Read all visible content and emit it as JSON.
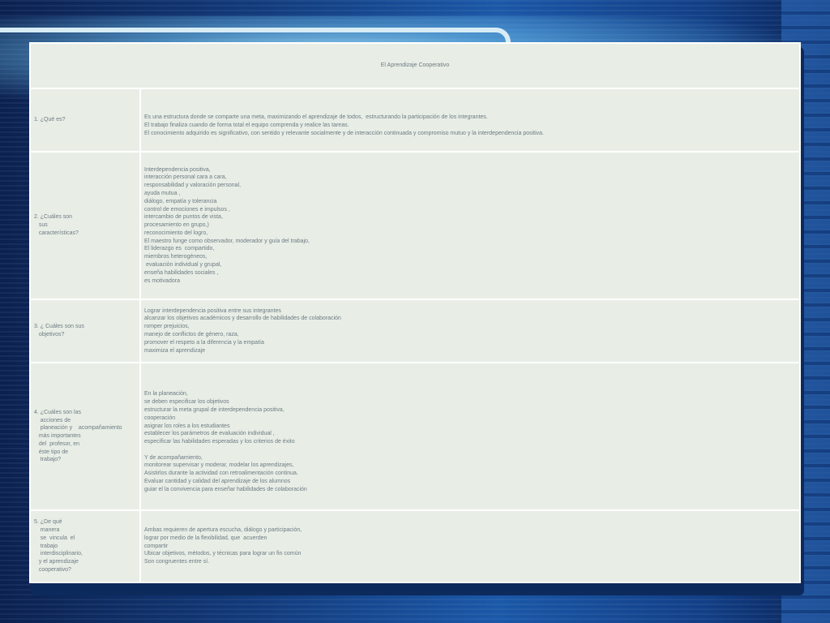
{
  "title": "El Aprendizaje Cooperativo",
  "rows": [
    {
      "question": [
        "1. ¿Qué es?"
      ],
      "answer": [
        "Es una estructura donde se comparte una meta, maximizando el aprendizaje de todos,  estructurando la participación de los integrantes.",
        "El trabajo finaliza cuando de forma total el equipo comprenda y realice las tareas.",
        "El conocimiento adquirido es significativo, con sentido y relevante socialmente y de interacción continuada y compromiso mutuo y la interdependencia positiva."
      ]
    },
    {
      "question": [
        "2. ¿Cuáles son",
        "   sus",
        "   características?"
      ],
      "answer": [
        "Interdependencia positiva,",
        "interacción personal cara a cara,",
        "responsabilidad y valoración personal,",
        "ayuda mutua ,",
        "diálogo, empatía y tolerancia",
        "control de emociones e impulsos ,",
        "intercambio de puntos de vista,",
        "procesamiento en grupo,)",
        "reconocimiento del logro,",
        "El maestro funge como observador, moderador y guía del trabajo,",
        "El liderazgo es  compartido,",
        "miembros heterogéneos,",
        " evaluación individual y grupal,",
        "enseña habilidades sociales ,",
        "es motivadora"
      ]
    },
    {
      "question": [
        "3. ¿ Cuáles son sus",
        "   objetivos?"
      ],
      "answer": [
        "Lograr interdependencia positiva entre sus integrantes",
        "alcanzar los objetivos académicos y desarrollo de habilidades de colaboración",
        "romper prejuicios,",
        "manejo de conflictos de género, raza,",
        "promover el respeto a la diferencia y la empatía",
        "maximiza el aprendizaje"
      ]
    },
    {
      "question": [
        "4. ¿Cuáles son las",
        "    acciones de",
        "    planeación y    acompañamiento",
        "   más importantes",
        "   del  profesor, en",
        "   éste tipo de",
        "    trabajo?"
      ],
      "answer": [
        "En la planeación,",
        "se deben especificar los objetivos",
        "estructurar la meta grupal de interdependencia positiva,",
        "cooperación",
        "asignar los roles a los estudiantes",
        "establecer los parámetros de evaluación individual ,",
        "especificar las habilidades esperadas y los criterios de éxito",
        "",
        "Y de acompañamiento,",
        "monitorear supervisar y moderar, modelar los aprendizajes,",
        "Asistirlos durante la actividad con retroalimentación continua.",
        "Evaluar cantidad y calidad del aprendizaje de los alumnos",
        "guiar el la convivencia para enseñar habilidades de colaboración"
      ]
    },
    {
      "question": [
        "5. ¿De qué",
        "    manera",
        "    se  vincula  el",
        "    trabajo",
        "    interdisciplinario,",
        "   y el aprendizaje",
        "   cooperativo?"
      ],
      "answer": [
        "Ambas requieren de apertura escucha, diálogo y participación,",
        "lograr por medio de la flexibilidad, que  acuerden",
        "compartir",
        "Ubicar objetivos, métodos, y técnicas para lograr un fin común",
        "Son congruentes entre sí."
      ]
    }
  ]
}
